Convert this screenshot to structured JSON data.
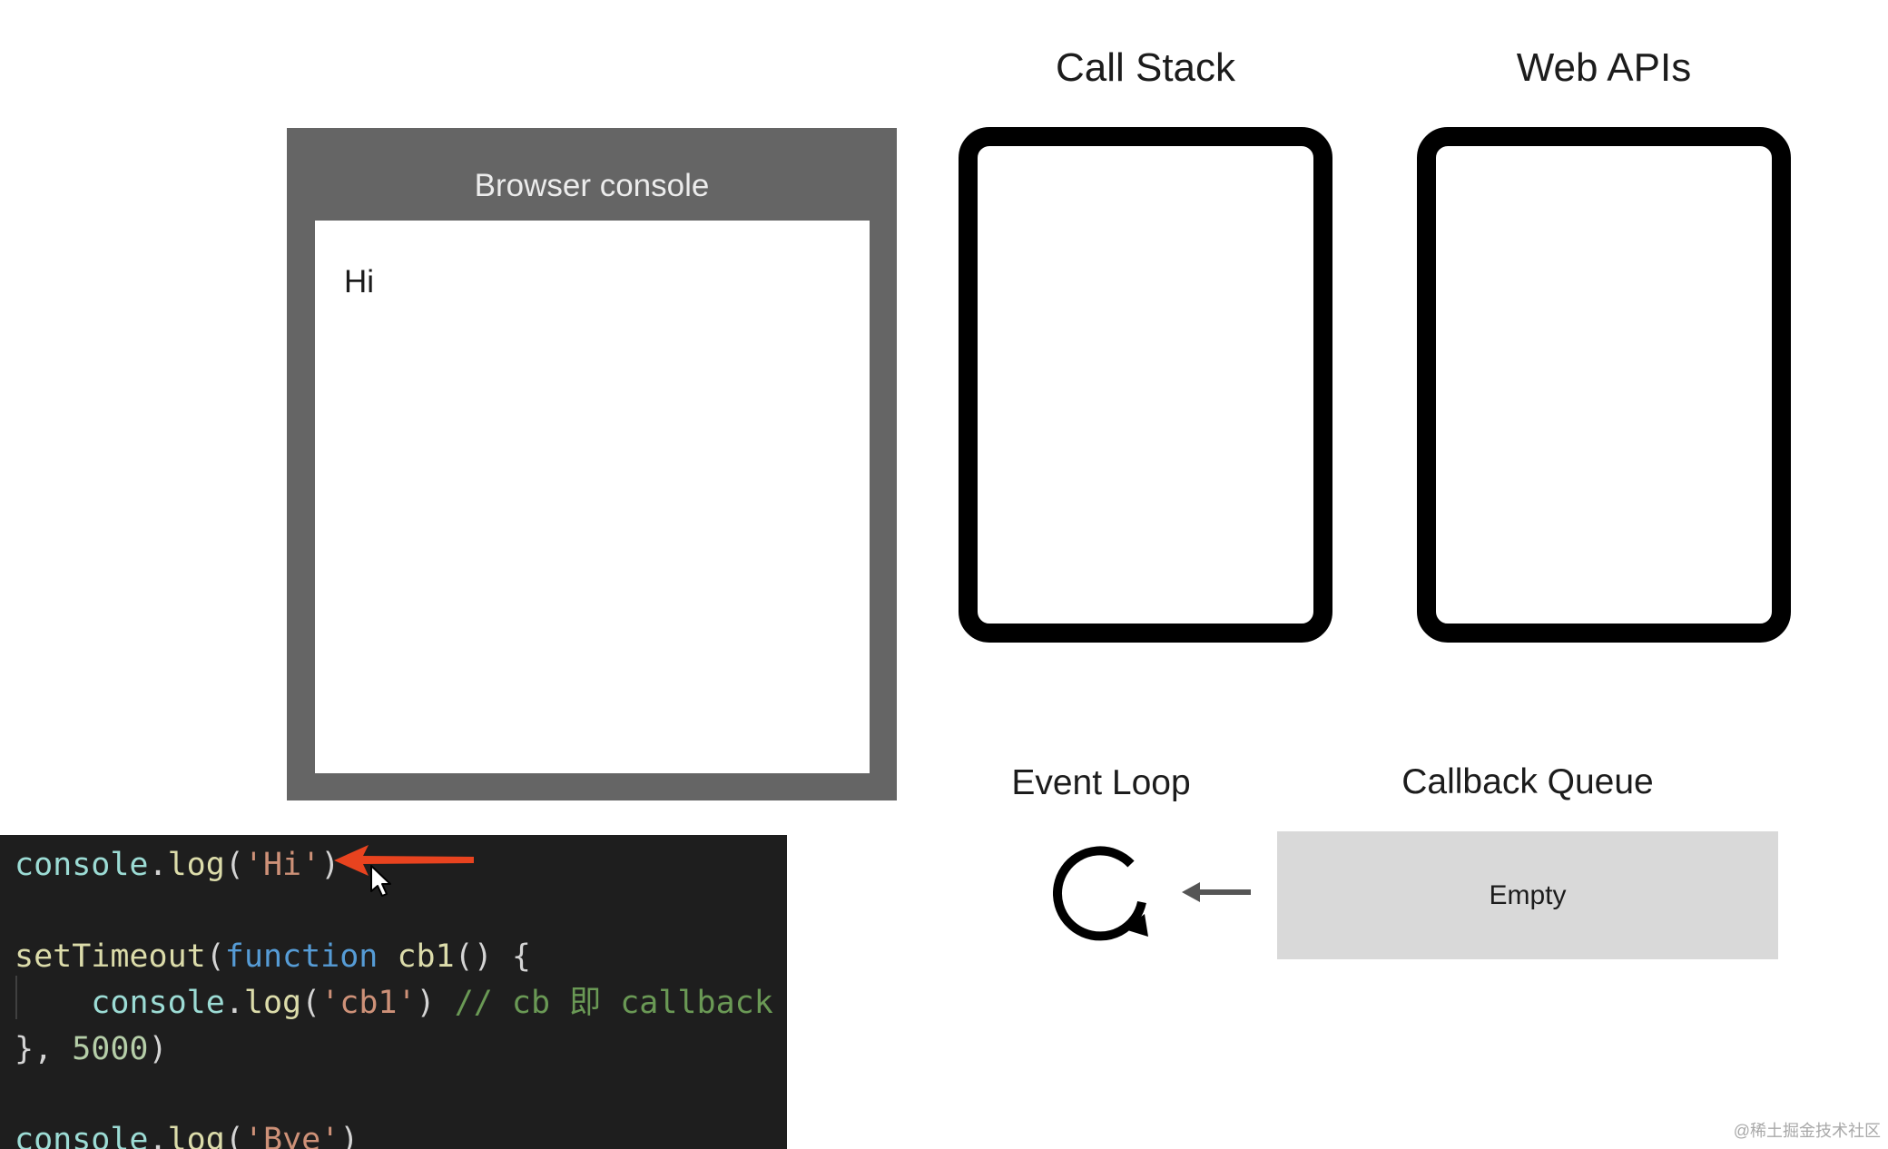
{
  "titles": {
    "call_stack": "Call Stack",
    "web_apis": "Web APIs",
    "event_loop": "Event Loop",
    "callback_queue": "Callback Queue"
  },
  "console": {
    "title": "Browser console",
    "output": [
      "Hi"
    ]
  },
  "queue": {
    "status": "Empty"
  },
  "code": {
    "line1": {
      "obj": "console",
      "dot": ".",
      "fn": "log",
      "open": "(",
      "str": "'Hi'",
      "close": ")"
    },
    "line3": {
      "fn": "setTimeout",
      "open": "(",
      "kw": "function",
      "name": " cb1",
      "rest": "() {"
    },
    "line4": {
      "indent": "    ",
      "obj": "console",
      "dot": ".",
      "fn": "log",
      "open": "(",
      "str": "'cb1'",
      "close": ") ",
      "comment": "// cb 即 callback"
    },
    "line5": {
      "brace": "}, ",
      "num": "5000",
      "close": ")"
    },
    "line7": {
      "obj": "console",
      "dot": ".",
      "fn": "log",
      "open": "(",
      "str": "'Bye'",
      "close": ")"
    }
  },
  "watermark": "@稀土掘金技术社区",
  "colors": {
    "console_frame": "#656565",
    "editor_bg": "#1e1e1e",
    "pointer_arrow": "#e8431f",
    "queue_bg": "#d9d9d9"
  }
}
